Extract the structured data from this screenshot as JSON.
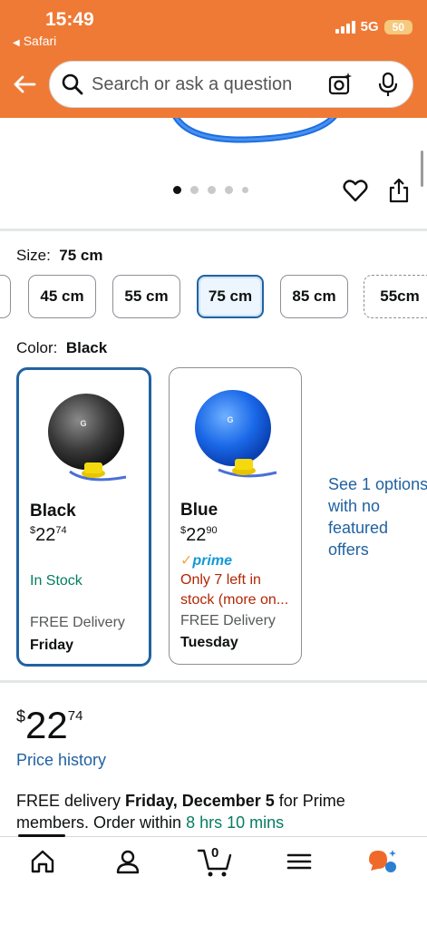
{
  "status_bar": {
    "time": "15:49",
    "back_app": "Safari",
    "network": "5G",
    "battery": "50"
  },
  "search": {
    "placeholder": "Search or ask a question"
  },
  "carousel": {
    "dot_count": 5,
    "active_index": 0
  },
  "size": {
    "label": "Size:",
    "value": "75 cm",
    "options": [
      "45 cm",
      "55 cm",
      "75 cm",
      "85 cm",
      "55cm"
    ],
    "selected_index": 2
  },
  "color": {
    "label": "Color:",
    "value": "Black",
    "options": [
      {
        "name": "Black",
        "price_symbol": "$",
        "price_whole": "22",
        "price_fraction": "74",
        "stock": "In Stock",
        "delivery": "FREE Delivery",
        "delivery_day": "Friday"
      },
      {
        "name": "Blue",
        "price_symbol": "$",
        "price_whole": "22",
        "price_fraction": "90",
        "prime": "prime",
        "stock_line1": "Only 7 left in",
        "stock_line2": "stock (more on...",
        "delivery": "FREE Delivery",
        "delivery_day": "Tuesday"
      }
    ],
    "see_options": "See 1 options with no featured offers"
  },
  "buybox": {
    "price_symbol": "$",
    "price_whole": "22",
    "price_fraction": "74",
    "price_history": "Price history",
    "delivery_prefix": "FREE delivery ",
    "delivery_date": "Friday, December 5",
    "delivery_middle": " for Prime members. Order within ",
    "delivery_countdown": "8 hrs 10 mins"
  },
  "bottom_nav": {
    "cart_count": "0",
    "items": [
      "home-icon",
      "account-icon",
      "cart-icon",
      "menu-icon",
      "rufus-icon"
    ]
  },
  "colors": {
    "header_orange": "#ef7a36",
    "link_blue": "#2162a1",
    "in_stock_green": "#067d62",
    "low_stock_red": "#b12704"
  }
}
